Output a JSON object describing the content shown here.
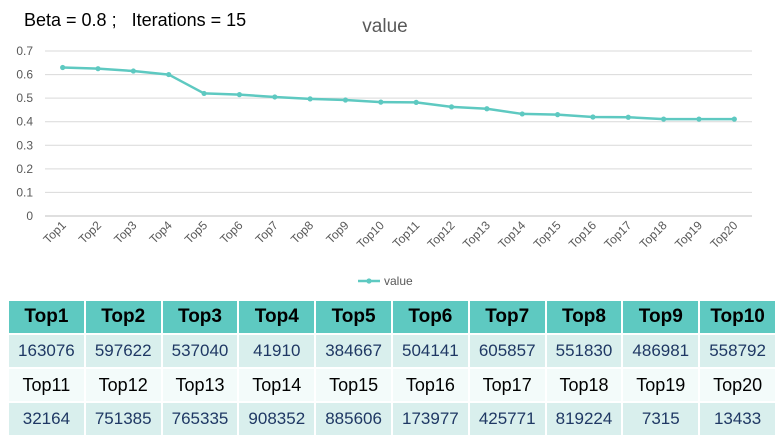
{
  "caption": "Beta = 0.8 ;   Iterations = 15",
  "chart_data": {
    "type": "line",
    "title": "value",
    "categories": [
      "Top1",
      "Top2",
      "Top3",
      "Top4",
      "Top5",
      "Top6",
      "Top7",
      "Top8",
      "Top9",
      "Top10",
      "Top11",
      "Top12",
      "Top13",
      "Top14",
      "Top15",
      "Top16",
      "Top17",
      "Top18",
      "Top19",
      "Top20"
    ],
    "series": [
      {
        "name": "value",
        "values": [
          0.63,
          0.625,
          0.615,
          0.6,
          0.52,
          0.515,
          0.505,
          0.497,
          0.492,
          0.483,
          0.482,
          0.463,
          0.455,
          0.433,
          0.43,
          0.42,
          0.419,
          0.411,
          0.411,
          0.411
        ],
        "color": "#5ec9c1"
      }
    ],
    "ylim": [
      0,
      0.7
    ],
    "yticks": [
      "0",
      "0.1",
      "0.2",
      "0.3",
      "0.4",
      "0.5",
      "0.6",
      "0.7"
    ],
    "grid": true,
    "legend": "bottom"
  },
  "table": {
    "header": [
      "Top1",
      "Top2",
      "Top3",
      "Top4",
      "Top5",
      "Top6",
      "Top7",
      "Top8",
      "Top9",
      "Top10"
    ],
    "row1": [
      "163076",
      "597622",
      "537040",
      "41910",
      "384667",
      "504141",
      "605857",
      "551830",
      "486981",
      "558792"
    ],
    "labels2": [
      "Top11",
      "Top12",
      "Top13",
      "Top14",
      "Top15",
      "Top16",
      "Top17",
      "Top18",
      "Top19",
      "Top20"
    ],
    "row2": [
      "32164",
      "751385",
      "765335",
      "908352",
      "885606",
      "173977",
      "425771",
      "819224",
      "7315",
      "13433"
    ]
  }
}
